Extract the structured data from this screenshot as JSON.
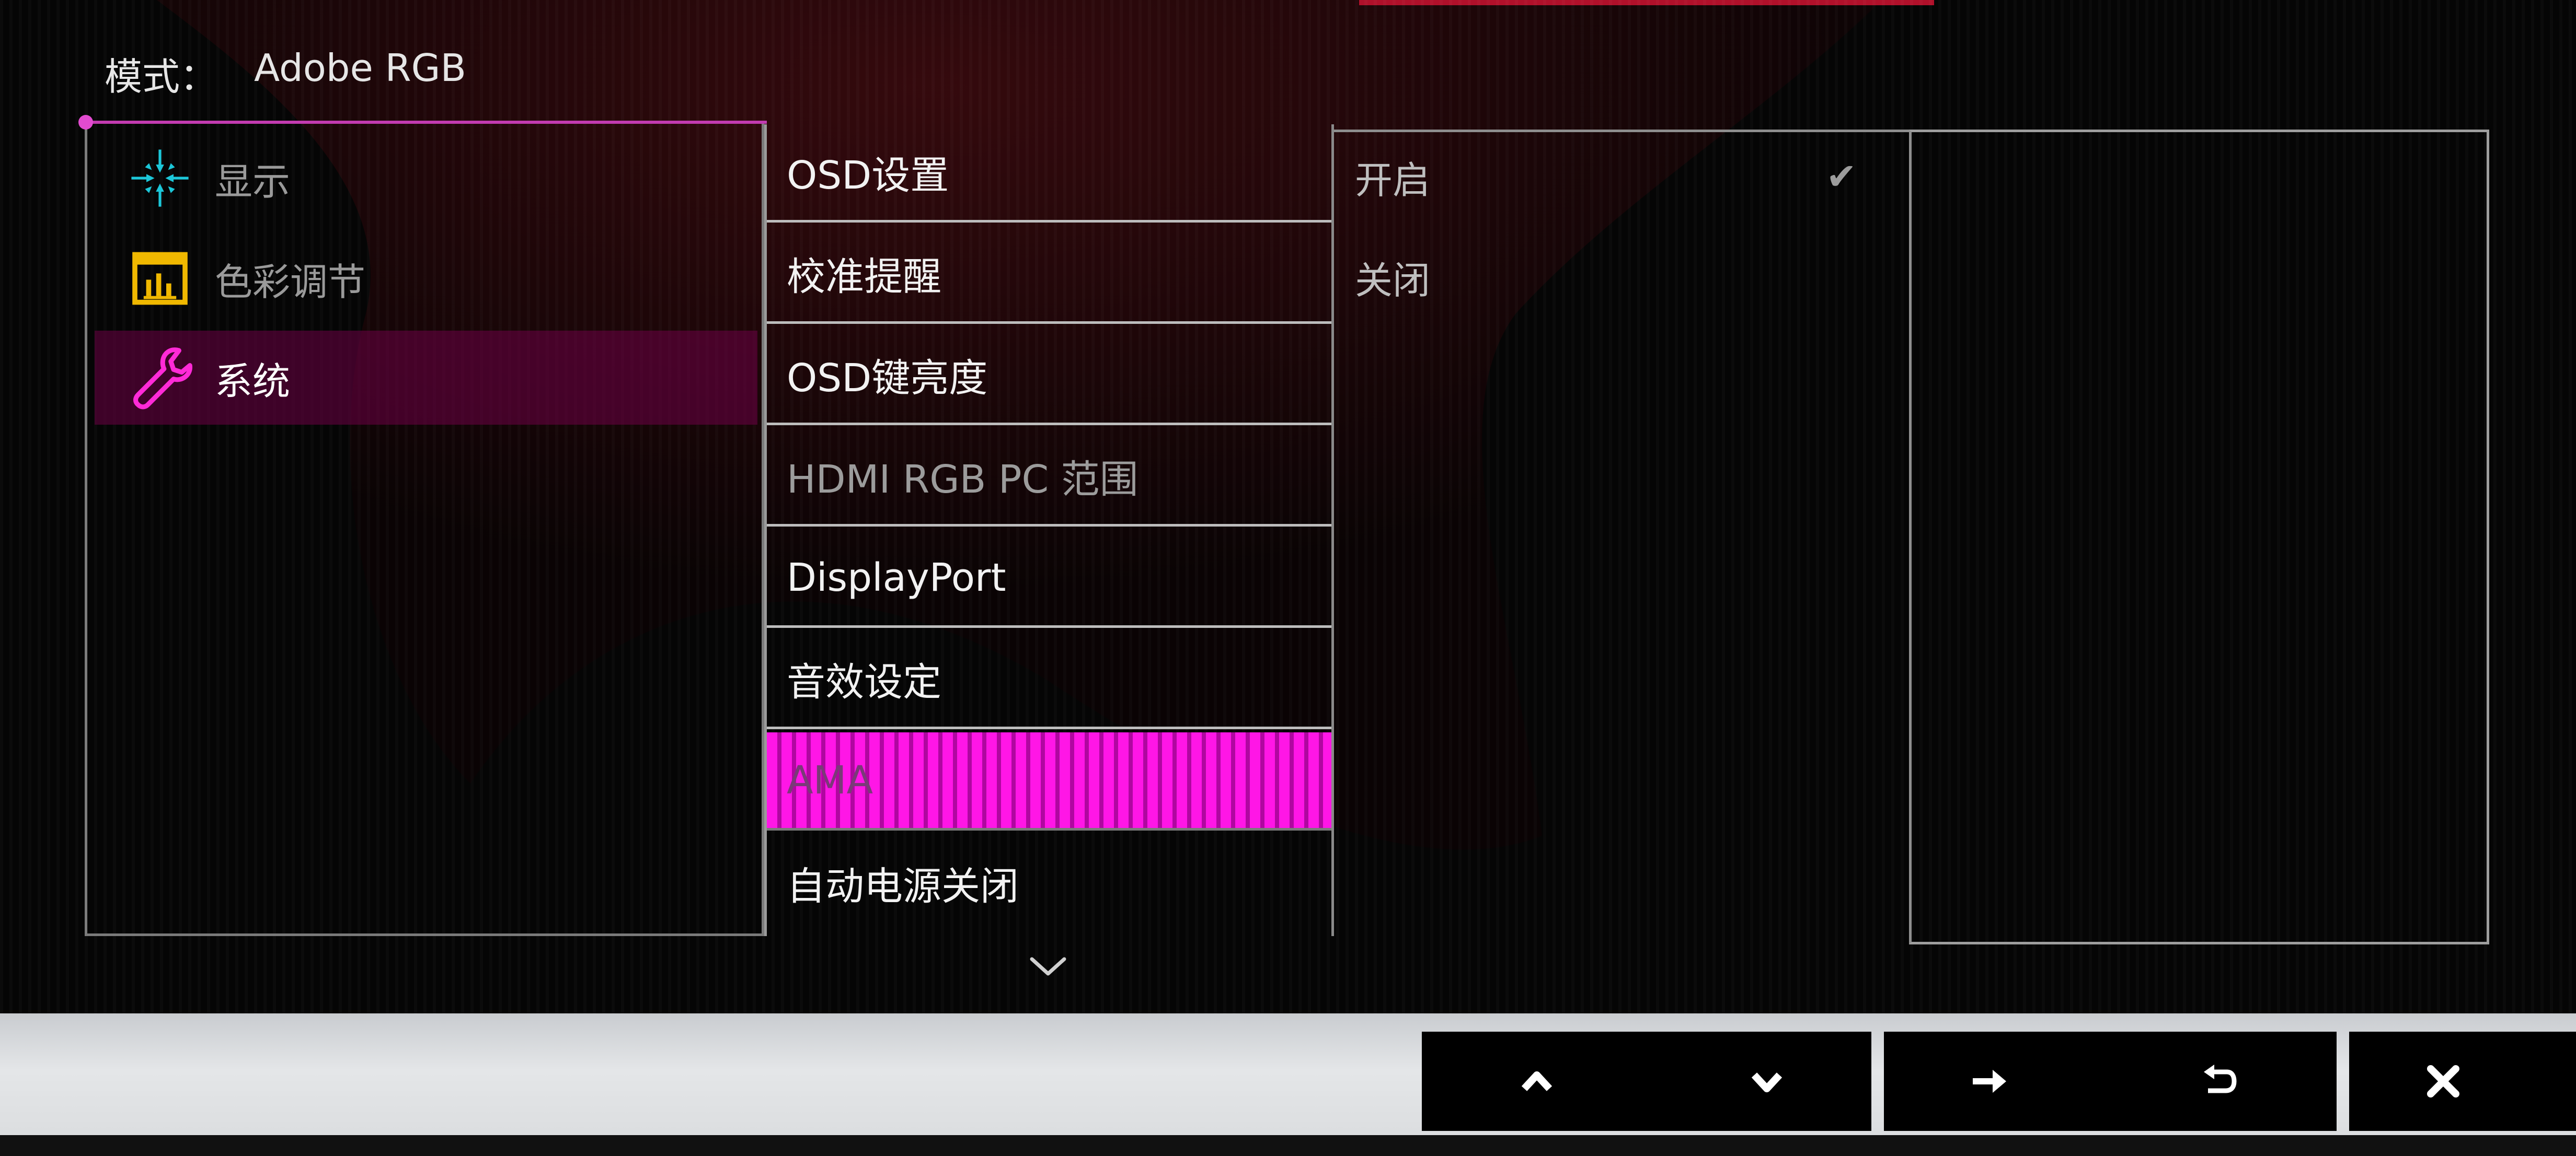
{
  "header": {
    "mode_label": "模式：",
    "mode_value": "Adobe RGB"
  },
  "categories": [
    {
      "label": "显示",
      "icon": "display-arrows-icon",
      "color": "#1cc7d9",
      "active": false
    },
    {
      "label": "色彩调节",
      "icon": "color-adjust-icon",
      "color": "#f0b800",
      "active": false
    },
    {
      "label": "系统",
      "icon": "wrench-icon",
      "color": "#ff2ad7",
      "active": true
    }
  ],
  "menu_items": [
    {
      "label": "OSD设置",
      "state": "normal"
    },
    {
      "label": "校准提醒",
      "state": "normal"
    },
    {
      "label": "OSD键亮度",
      "state": "normal"
    },
    {
      "label": "HDMI RGB PC 范围",
      "state": "disabled"
    },
    {
      "label": "DisplayPort",
      "state": "normal"
    },
    {
      "label": "音效设定",
      "state": "normal"
    },
    {
      "label": "AMA",
      "state": "selected"
    },
    {
      "label": "自动电源关闭",
      "state": "normal"
    }
  ],
  "options": [
    {
      "label": "开启",
      "checked": true
    },
    {
      "label": "关闭",
      "checked": false
    }
  ],
  "icons": {
    "scroll_down": "chevron-down-icon",
    "keys": [
      "up-arrow-icon",
      "down-arrow-icon",
      "right-arrow-icon",
      "return-icon",
      "close-icon"
    ]
  },
  "colors": {
    "accent": "#ff16e6",
    "frame": "#8a8a8a",
    "background": "#050505"
  }
}
